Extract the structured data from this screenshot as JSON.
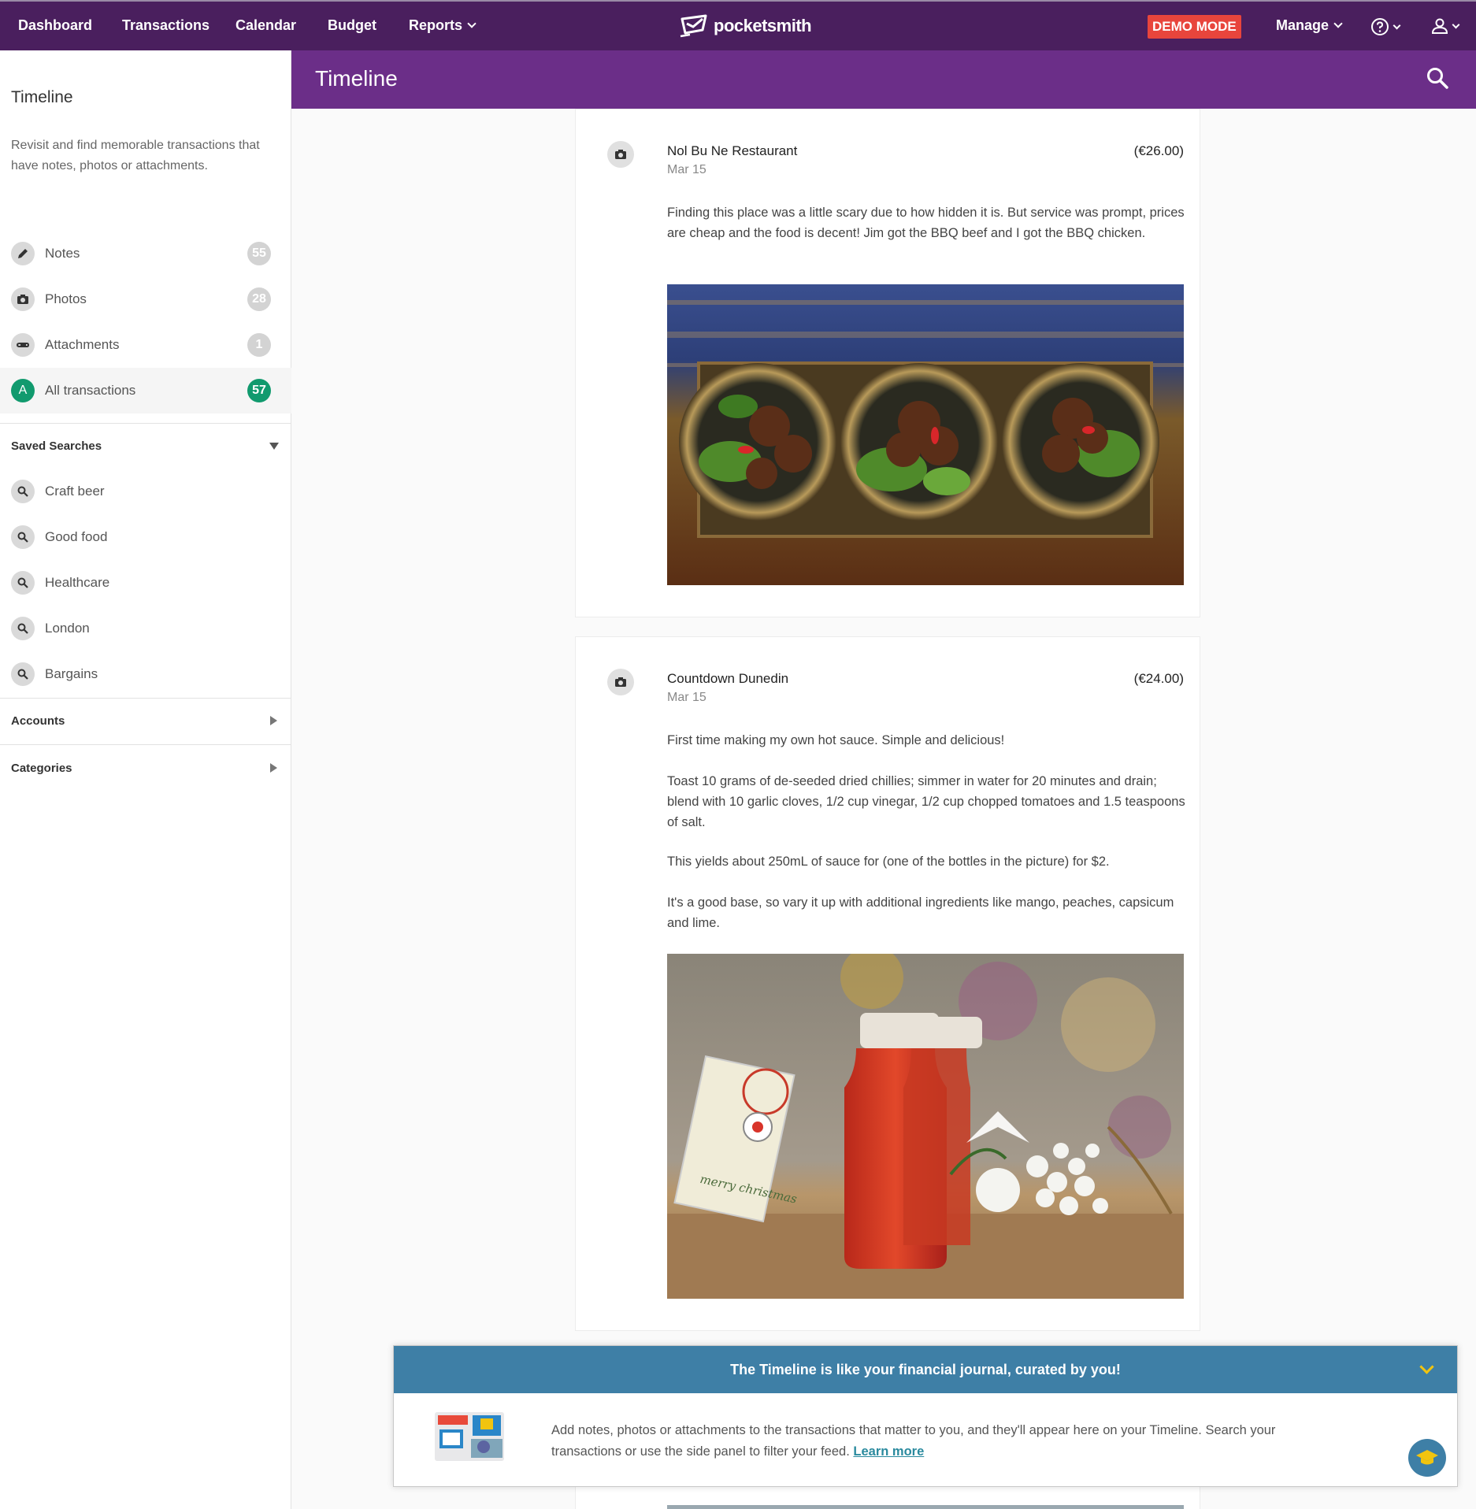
{
  "nav": {
    "items": [
      "Dashboard",
      "Transactions",
      "Calendar",
      "Budget",
      "Reports"
    ],
    "logo": "pocketsmith",
    "demo_badge": "DEMO MODE",
    "manage": "Manage"
  },
  "sidebar": {
    "title": "Timeline",
    "description": "Revisit and find memorable transactions that have notes, photos or attachments.",
    "filters": [
      {
        "label": "Notes",
        "count": "55",
        "icon": "pencil-icon"
      },
      {
        "label": "Photos",
        "count": "28",
        "icon": "camera-icon"
      },
      {
        "label": "Attachments",
        "count": "1",
        "icon": "paperclip-icon"
      },
      {
        "label": "All transactions",
        "count": "57",
        "icon_letter": "A"
      }
    ],
    "saved_searches_label": "Saved Searches",
    "saved_searches": [
      "Craft beer",
      "Good food",
      "Healthcare",
      "London",
      "Bargains"
    ],
    "accounts_label": "Accounts",
    "categories_label": "Categories"
  },
  "header": {
    "title": "Timeline"
  },
  "cards": [
    {
      "merchant": "Nol Bu Ne Restaurant",
      "amount": "(€26.00)",
      "date": "Mar 15",
      "note": "Finding this place was a little scary due to how hidden it is. But service was prompt, prices are cheap and the food is decent! Jim got the BBQ beef and I got the BBQ chicken."
    },
    {
      "merchant": "Countdown Dunedin",
      "amount": "(€24.00)",
      "date": "Mar 15",
      "paragraphs": [
        "First time making my own hot sauce. Simple and delicious!",
        "Toast 10 grams of de-seeded dried chillies; simmer in water for 20 minutes and drain; blend with 10 garlic cloves, 1/2 cup vinegar, 1/2 cup chopped tomatoes and 1.5 teaspoons of salt.",
        "This yields about 250mL of sauce for (one of the bottles in the picture) for $2.",
        "It's a good base, so vary it up with additional ingredients like mango, peaches, capsicum and lime."
      ],
      "photo_label": "merry christmas"
    }
  ],
  "tip": {
    "title": "The Timeline is like your financial journal, curated by you!",
    "body": "Add notes, photos or attachments to the transactions that matter to you, and they'll appear here on your Timeline. Search your transactions or use the side panel to filter your feed.",
    "link": "Learn more"
  },
  "colors": {
    "nav_bg": "#4a1f5e",
    "header_bg": "#6b2e88",
    "demo_red": "#e8453c",
    "green": "#119a6e",
    "tip_blue": "#3e7fa6"
  }
}
